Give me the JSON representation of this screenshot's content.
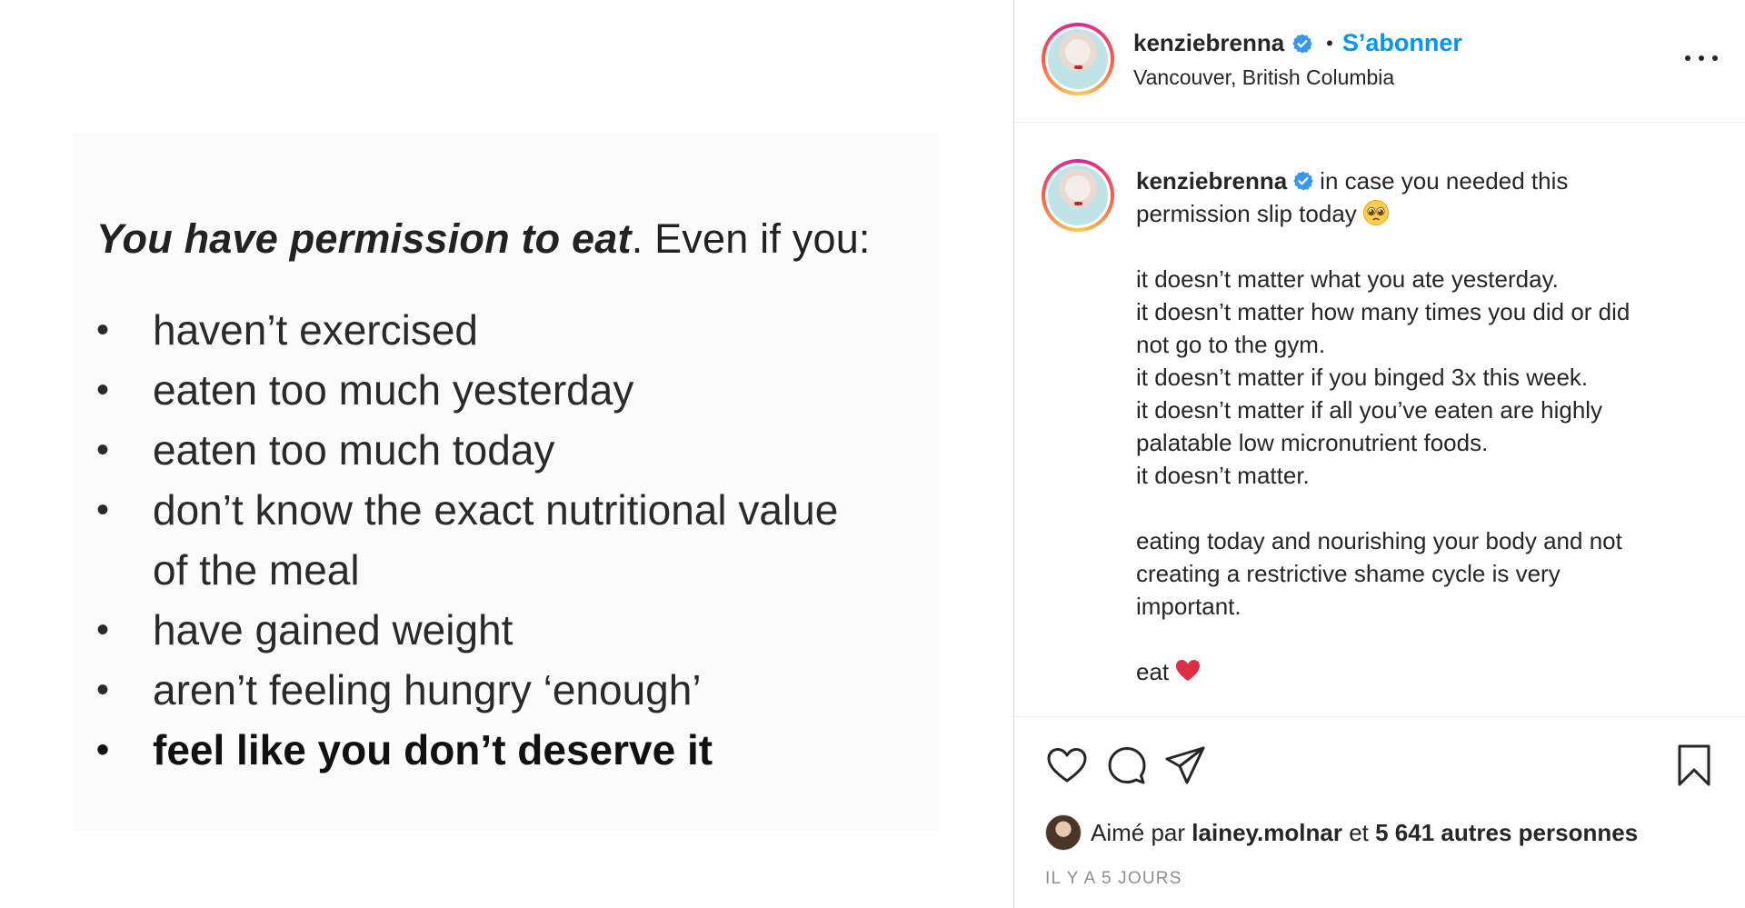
{
  "media": {
    "heading_bold": "You have permission to eat",
    "heading_rest": ". Even if you:",
    "items": [
      {
        "text": "haven’t exercised"
      },
      {
        "text": "eaten too much yesterday"
      },
      {
        "text": "eaten too much today"
      },
      {
        "text": "don’t know the exact nutritional value"
      },
      {
        "text": "of the meal"
      },
      {
        "text": "have gained weight"
      },
      {
        "text": "aren’t feeling hungry ‘enough’"
      },
      {
        "text": "feel like you don’t deserve it"
      }
    ]
  },
  "header": {
    "username": "kenziebrenna",
    "separator": "•",
    "follow_label": "S’abonner",
    "location": "Vancouver, British Columbia",
    "verified_icon": "verified-badge-icon",
    "more_icon": "more-options-icon"
  },
  "caption": {
    "username": "kenziebrenna",
    "intro_1": "in case you needed this",
    "intro_2": "permission slip today",
    "intro_emoji": "pleading-face-emoji",
    "lines": [
      "it doesn’t matter what you ate yesterday.",
      "it doesn’t matter how many times you did or did",
      "not go to the gym.",
      "it doesn’t matter if you binged 3x this week.",
      "it doesn’t matter if all you’ve eaten are highly",
      "palatable low micronutrient foods.",
      "it doesn’t matter."
    ],
    "para2": [
      "eating today and nourishing your body and not",
      "creating a restrictive shame cycle is very",
      "important."
    ],
    "closing": "eat",
    "closing_emoji": "red-heart-emoji"
  },
  "actions": {
    "like_icon": "heart-icon",
    "comment_icon": "comment-icon",
    "share_icon": "paper-plane-icon",
    "save_icon": "bookmark-icon"
  },
  "likes": {
    "prefix": "Aimé par",
    "liker": "lainey.molnar",
    "connector": "et",
    "others": "5 641 autres personnes"
  },
  "timestamp": "IL Y A 5 JOURS",
  "colors": {
    "accent": "#0095f6",
    "text": "#262626",
    "muted": "#8e8e8e",
    "heart": "#e0245e"
  }
}
